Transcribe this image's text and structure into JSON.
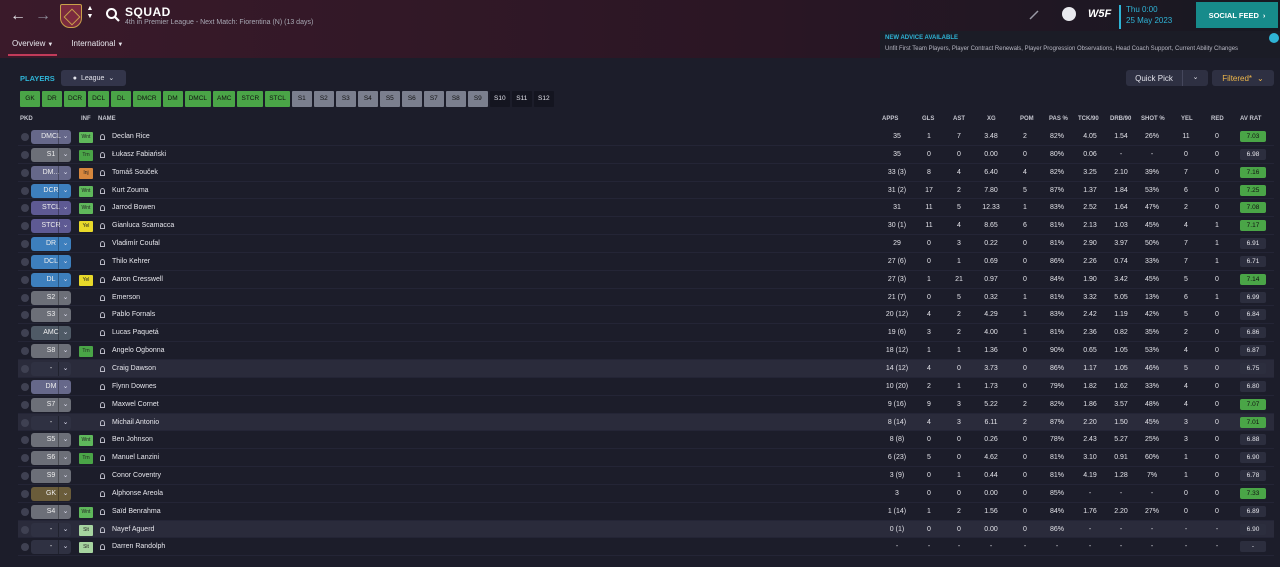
{
  "header": {
    "title": "SQUAD",
    "subtitle": "4th in Premier League - Next Match: Fiorentina (N) (13 days)",
    "tabs": [
      {
        "label": "Overview"
      },
      {
        "label": "International"
      }
    ],
    "date_time": "Thu 0:00",
    "date_day": "25 May 2023",
    "social_feed": "SOCIAL FEED",
    "w5f_label": "W5F"
  },
  "advice": {
    "heading": "NEW ADVICE AVAILABLE",
    "body": "Unfit First Team Players, Player Contract Renewals, Player Progression Observations, Head Coach Support, Current Ability Changes"
  },
  "toolbar": {
    "players_label": "PLAYERS",
    "league_label": "League",
    "quick_pick": "Quick Pick",
    "filtered": "Filtered*"
  },
  "position_filters": [
    {
      "label": "GK",
      "kind": "g"
    },
    {
      "label": "DR",
      "kind": "g"
    },
    {
      "label": "DCR",
      "kind": "g"
    },
    {
      "label": "DCL",
      "kind": "g"
    },
    {
      "label": "DL",
      "kind": "g"
    },
    {
      "label": "DMCR",
      "kind": "g"
    },
    {
      "label": "DM",
      "kind": "g"
    },
    {
      "label": "DMCL",
      "kind": "g"
    },
    {
      "label": "AMC",
      "kind": "g"
    },
    {
      "label": "STCR",
      "kind": "g"
    },
    {
      "label": "STCL",
      "kind": "g"
    },
    {
      "label": "S1",
      "kind": "s"
    },
    {
      "label": "S2",
      "kind": "s"
    },
    {
      "label": "S3",
      "kind": "s"
    },
    {
      "label": "S4",
      "kind": "s"
    },
    {
      "label": "S5",
      "kind": "s"
    },
    {
      "label": "S6",
      "kind": "s"
    },
    {
      "label": "S7",
      "kind": "s"
    },
    {
      "label": "S8",
      "kind": "s"
    },
    {
      "label": "S9",
      "kind": "s"
    },
    {
      "label": "S10",
      "kind": "n"
    },
    {
      "label": "S11",
      "kind": "n"
    },
    {
      "label": "S12",
      "kind": "n"
    }
  ],
  "columns": {
    "pkd": "PKD",
    "inf": "INF",
    "name": "NAME",
    "apps": "APPS",
    "gls": "GLS",
    "ast": "AST",
    "xg": "XG",
    "pom": "POM",
    "pas": "PAS %",
    "tck": "TCK/90",
    "drb": "DRB/90",
    "shot": "SHOT %",
    "yel": "YEL",
    "red": "RED",
    "avr": "AV RAT"
  },
  "players": [
    {
      "pkd": "DMCL",
      "pc": "tact-m",
      "inf": "Wnt",
      "ic": "wnt",
      "name": "Declan Rice",
      "apps": "35",
      "gls": "1",
      "ast": "7",
      "xg": "3.48",
      "pom": "2",
      "pas": "82%",
      "tck": "4.05",
      "drb": "1.54",
      "shot": "26%",
      "yel": "11",
      "red": "0",
      "avr": "7.03",
      "ac": "hi"
    },
    {
      "pkd": "S1",
      "pc": "tact-s",
      "inf": "Trn",
      "ic": "trn",
      "name": "Łukasz Fabiański",
      "apps": "35",
      "gls": "0",
      "ast": "0",
      "xg": "0.00",
      "pom": "0",
      "pas": "80%",
      "tck": "0.06",
      "drb": "-",
      "shot": "-",
      "yel": "0",
      "red": "0",
      "avr": "6.98",
      "ac": "lo"
    },
    {
      "pkd": "DM...",
      "pc": "tact-m",
      "inf": "Inj",
      "ic": "inj",
      "name": "Tomáš Souček",
      "apps": "33 (3)",
      "gls": "8",
      "ast": "4",
      "xg": "6.40",
      "pom": "4",
      "pas": "82%",
      "tck": "3.25",
      "drb": "2.10",
      "shot": "39%",
      "yel": "7",
      "red": "0",
      "avr": "7.16",
      "ac": "hi"
    },
    {
      "pkd": "DCR",
      "pc": "tact-d",
      "inf": "Wnt",
      "ic": "wnt",
      "name": "Kurt Zouma",
      "apps": "31 (2)",
      "gls": "17",
      "ast": "2",
      "xg": "7.80",
      "pom": "5",
      "pas": "87%",
      "tck": "1.37",
      "drb": "1.84",
      "shot": "53%",
      "yel": "6",
      "red": "0",
      "avr": "7.25",
      "ac": "hi"
    },
    {
      "pkd": "STCL",
      "pc": "tact-f",
      "inf": "Wnt",
      "ic": "wnt",
      "name": "Jarrod Bowen",
      "apps": "31",
      "gls": "11",
      "ast": "5",
      "xg": "12.33",
      "pom": "1",
      "pas": "83%",
      "tck": "2.52",
      "drb": "1.64",
      "shot": "47%",
      "yel": "2",
      "red": "0",
      "avr": "7.08",
      "ac": "hi"
    },
    {
      "pkd": "STCR",
      "pc": "tact-f",
      "inf": "Yel",
      "ic": "yel",
      "name": "Gianluca Scamacca",
      "apps": "30 (1)",
      "gls": "11",
      "ast": "4",
      "xg": "8.65",
      "pom": "6",
      "pas": "81%",
      "tck": "2.13",
      "drb": "1.03",
      "shot": "45%",
      "yel": "4",
      "red": "1",
      "avr": "7.17",
      "ac": "hi"
    },
    {
      "pkd": "DR",
      "pc": "tact-d",
      "inf": "",
      "ic": "",
      "name": "Vladimír Coufal",
      "apps": "29",
      "gls": "0",
      "ast": "3",
      "xg": "0.22",
      "pom": "0",
      "pas": "81%",
      "tck": "2.90",
      "drb": "3.97",
      "shot": "50%",
      "yel": "7",
      "red": "1",
      "avr": "6.91",
      "ac": "lo"
    },
    {
      "pkd": "DCL",
      "pc": "tact-d",
      "inf": "",
      "ic": "",
      "name": "Thilo Kehrer",
      "apps": "27 (6)",
      "gls": "0",
      "ast": "1",
      "xg": "0.69",
      "pom": "0",
      "pas": "86%",
      "tck": "2.26",
      "drb": "0.74",
      "shot": "33%",
      "yel": "7",
      "red": "1",
      "avr": "6.71",
      "ac": "lo"
    },
    {
      "pkd": "DL",
      "pc": "tact-d",
      "inf": "Yel",
      "ic": "yel",
      "name": "Aaron Cresswell",
      "apps": "27 (3)",
      "gls": "1",
      "ast": "21",
      "xg": "0.97",
      "pom": "0",
      "pas": "84%",
      "tck": "1.90",
      "drb": "3.42",
      "shot": "45%",
      "yel": "5",
      "red": "0",
      "avr": "7.14",
      "ac": "hi"
    },
    {
      "pkd": "S2",
      "pc": "tact-s",
      "inf": "",
      "ic": "",
      "name": "Emerson",
      "apps": "21 (7)",
      "gls": "0",
      "ast": "5",
      "xg": "0.32",
      "pom": "1",
      "pas": "81%",
      "tck": "3.32",
      "drb": "5.05",
      "shot": "13%",
      "yel": "6",
      "red": "1",
      "avr": "6.99",
      "ac": "lo"
    },
    {
      "pkd": "S3",
      "pc": "tact-s",
      "inf": "",
      "ic": "",
      "name": "Pablo Fornals",
      "apps": "20 (12)",
      "gls": "4",
      "ast": "2",
      "xg": "4.29",
      "pom": "1",
      "pas": "83%",
      "tck": "2.42",
      "drb": "1.19",
      "shot": "42%",
      "yel": "5",
      "red": "0",
      "avr": "6.84",
      "ac": "lo"
    },
    {
      "pkd": "AMC",
      "pc": "tact-mg",
      "inf": "",
      "ic": "",
      "name": "Lucas Paquetá",
      "apps": "19 (6)",
      "gls": "3",
      "ast": "2",
      "xg": "4.00",
      "pom": "1",
      "pas": "81%",
      "tck": "2.36",
      "drb": "0.82",
      "shot": "35%",
      "yel": "2",
      "red": "0",
      "avr": "6.86",
      "ac": "lo"
    },
    {
      "pkd": "S8",
      "pc": "tact-s",
      "inf": "Trn",
      "ic": "trn",
      "name": "Angelo Ogbonna",
      "apps": "18 (12)",
      "gls": "1",
      "ast": "1",
      "xg": "1.36",
      "pom": "0",
      "pas": "90%",
      "tck": "0.65",
      "drb": "1.05",
      "shot": "53%",
      "yel": "4",
      "red": "0",
      "avr": "6.87",
      "ac": "lo"
    },
    {
      "pkd": "-",
      "pc": "none",
      "inf": "",
      "ic": "",
      "name": "Craig Dawson",
      "apps": "14 (12)",
      "gls": "4",
      "ast": "0",
      "xg": "3.73",
      "pom": "0",
      "pas": "86%",
      "tck": "1.17",
      "drb": "1.05",
      "shot": "46%",
      "yel": "5",
      "red": "0",
      "avr": "6.75",
      "ac": "lo",
      "hl": true
    },
    {
      "pkd": "DM",
      "pc": "tact-m",
      "inf": "",
      "ic": "",
      "name": "Flynn Downes",
      "apps": "10 (20)",
      "gls": "2",
      "ast": "1",
      "xg": "1.73",
      "pom": "0",
      "pas": "79%",
      "tck": "1.82",
      "drb": "1.62",
      "shot": "33%",
      "yel": "4",
      "red": "0",
      "avr": "6.80",
      "ac": "lo"
    },
    {
      "pkd": "S7",
      "pc": "tact-s",
      "inf": "",
      "ic": "",
      "name": "Maxwel Cornet",
      "apps": "9 (16)",
      "gls": "9",
      "ast": "3",
      "xg": "5.22",
      "pom": "2",
      "pas": "82%",
      "tck": "1.86",
      "drb": "3.57",
      "shot": "48%",
      "yel": "4",
      "red": "0",
      "avr": "7.07",
      "ac": "hi"
    },
    {
      "pkd": "-",
      "pc": "none",
      "inf": "",
      "ic": "",
      "name": "Michail Antonio",
      "apps": "8 (14)",
      "gls": "4",
      "ast": "3",
      "xg": "6.11",
      "pom": "2",
      "pas": "87%",
      "tck": "2.20",
      "drb": "1.50",
      "shot": "45%",
      "yel": "3",
      "red": "0",
      "avr": "7.01",
      "ac": "hi",
      "hl": true
    },
    {
      "pkd": "S5",
      "pc": "tact-s",
      "inf": "Wnt",
      "ic": "wnt",
      "name": "Ben Johnson",
      "apps": "8 (8)",
      "gls": "0",
      "ast": "0",
      "xg": "0.26",
      "pom": "0",
      "pas": "78%",
      "tck": "2.43",
      "drb": "5.27",
      "shot": "25%",
      "yel": "3",
      "red": "0",
      "avr": "6.88",
      "ac": "lo"
    },
    {
      "pkd": "S6",
      "pc": "tact-s",
      "inf": "Trn",
      "ic": "trn",
      "name": "Manuel Lanzini",
      "apps": "6 (23)",
      "gls": "5",
      "ast": "0",
      "xg": "4.62",
      "pom": "0",
      "pas": "81%",
      "tck": "3.10",
      "drb": "0.91",
      "shot": "60%",
      "yel": "1",
      "red": "0",
      "avr": "6.90",
      "ac": "lo"
    },
    {
      "pkd": "S9",
      "pc": "tact-s",
      "inf": "",
      "ic": "",
      "name": "Conor Coventry",
      "apps": "3 (9)",
      "gls": "0",
      "ast": "1",
      "xg": "0.44",
      "pom": "0",
      "pas": "81%",
      "tck": "4.19",
      "drb": "1.28",
      "shot": "7%",
      "yel": "1",
      "red": "0",
      "avr": "6.78",
      "ac": "lo"
    },
    {
      "pkd": "GK",
      "pc": "tact-gk",
      "inf": "",
      "ic": "",
      "name": "Alphonse Areola",
      "apps": "3",
      "gls": "0",
      "ast": "0",
      "xg": "0.00",
      "pom": "0",
      "pas": "85%",
      "tck": "-",
      "drb": "-",
      "shot": "-",
      "yel": "0",
      "red": "0",
      "avr": "7.33",
      "ac": "hi"
    },
    {
      "pkd": "S4",
      "pc": "tact-s",
      "inf": "Wnt",
      "ic": "wnt",
      "name": "Saïd Benrahma",
      "apps": "1 (14)",
      "gls": "1",
      "ast": "2",
      "xg": "1.56",
      "pom": "0",
      "pas": "84%",
      "tck": "1.76",
      "drb": "2.20",
      "shot": "27%",
      "yel": "0",
      "red": "0",
      "avr": "6.89",
      "ac": "lo"
    },
    {
      "pkd": "-",
      "pc": "none",
      "inf": "Slt",
      "ic": "slt",
      "name": "Nayef Aguerd",
      "apps": "0 (1)",
      "gls": "0",
      "ast": "0",
      "xg": "0.00",
      "pom": "0",
      "pas": "86%",
      "tck": "-",
      "drb": "-",
      "shot": "-",
      "yel": "-",
      "red": "-",
      "avr": "6.90",
      "ac": "lo",
      "hl": true
    },
    {
      "pkd": "-",
      "pc": "none",
      "inf": "Slt",
      "ic": "slt",
      "name": "Darren Randolph",
      "apps": "-",
      "gls": "-",
      "ast": "-",
      "xg": "-",
      "pom": "-",
      "pas": "-",
      "tck": "-",
      "drb": "-",
      "shot": "-",
      "yel": "-",
      "red": "-",
      "avr": "-",
      "ac": "lo"
    }
  ]
}
